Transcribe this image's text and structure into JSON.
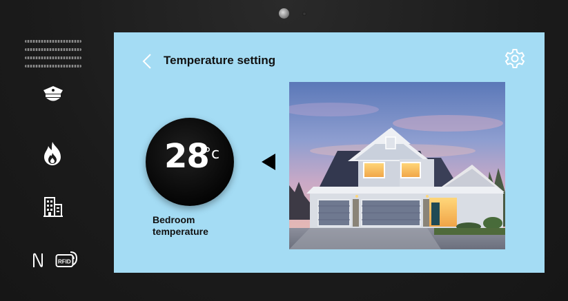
{
  "header": {
    "title": "Temperature setting",
    "back_icon": "chevron-left-icon",
    "settings_icon": "gear-icon"
  },
  "sidebar": {
    "icons": [
      "police-cap-icon",
      "flame-icon",
      "building-icon",
      "nfc-icon",
      "rfid-icon"
    ],
    "rfid_label": "RFID"
  },
  "thermostat": {
    "value": "28",
    "unit": "°c",
    "label": "Bedroom temperature"
  },
  "photo": {
    "subject": "house-photo"
  },
  "colors": {
    "screen_bg": "#a4dcf4",
    "bezel": "#1c1c1c",
    "dial": "#000000",
    "accent_icon": "#ffffff"
  }
}
